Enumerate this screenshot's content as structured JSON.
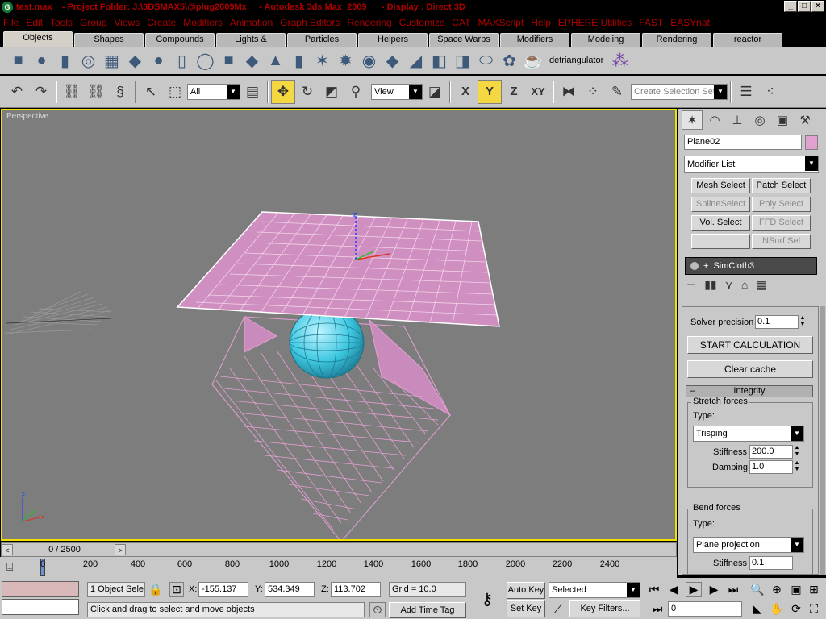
{
  "window": {
    "title": "test.max    - Project Folder: J:\\3DSMAX5\\@plug2009Mx     - Autodesk 3ds Max  2009      - Display : Direct 3D",
    "controls": [
      "_",
      "□",
      "×"
    ]
  },
  "menu": [
    "File",
    "Edit",
    "Tools",
    "Group",
    "Views",
    "Create",
    "Modifiers",
    "Animation",
    "Graph Editors",
    "Rendering",
    "Customize",
    "CAT",
    "MAXScript",
    "Help",
    "EPHERE Utilities",
    "FAST",
    "EASYnat"
  ],
  "tabs": [
    {
      "label": "Objects",
      "active": true
    },
    {
      "label": "Shapes"
    },
    {
      "label": "Compounds"
    },
    {
      "label": "Lights & Cameras"
    },
    {
      "label": "Particles"
    },
    {
      "label": "Helpers"
    },
    {
      "label": "Space Warps"
    },
    {
      "label": "Modifiers"
    },
    {
      "label": "Modeling"
    },
    {
      "label": "Rendering"
    },
    {
      "label": "reactor"
    }
  ],
  "obj_toolbar": {
    "icons": [
      "box-icon",
      "sphere-icon",
      "cylinder-icon",
      "torus-icon",
      "plane-icon",
      "box2-icon",
      "geosphere-icon",
      "tube-icon",
      "ring-icon",
      "chamferbox-icon",
      "pyramid-icon",
      "cone-icon",
      "oiltank-icon",
      "hedra-icon",
      "gear-icon",
      "capsule-icon",
      "spindle-icon",
      "prism-icon",
      "lext-icon",
      "cext-icon",
      "hose-icon",
      "knot-icon",
      "teapot-icon"
    ],
    "detriangulator_label": "detriangulator"
  },
  "main_toolbar": {
    "selection_filter": "All",
    "ref_coord": "View",
    "named_selection_placeholder": "Create Selection Set",
    "axis_x": "X",
    "axis_y": "Y",
    "axis_z": "Z",
    "axis_xy": "XY"
  },
  "viewport": {
    "label": "Perspective",
    "gizmo_axes": [
      "z",
      "x",
      "y"
    ]
  },
  "command_panel": {
    "object_name": "Plane02",
    "object_color": "#e0a0d0",
    "modifier_list": "Modifier List",
    "modifier_buttons": [
      {
        "label": "Mesh Select",
        "enabled": true
      },
      {
        "label": "Patch Select",
        "enabled": true
      },
      {
        "label": "SplineSelect",
        "enabled": false
      },
      {
        "label": "Poly Select",
        "enabled": false
      },
      {
        "label": "Vol. Select",
        "enabled": true
      },
      {
        "label": "FFD Select",
        "enabled": false
      },
      {
        "label": "",
        "enabled": true
      },
      {
        "label": "NSurf Sel",
        "enabled": false
      }
    ],
    "stack_item": "SimCloth3",
    "solver_precision_label": "Solver precision",
    "solver_precision_value": "0.1",
    "start_calculation": "START CALCULATION",
    "clear_cache": "Clear cache",
    "integrity_header": "Integrity",
    "stretch_forces": {
      "title": "Stretch forces",
      "type_label": "Type:",
      "type_value": "Trisping",
      "stiffness_label": "Stiffness",
      "stiffness_value": "200.0",
      "damping_label": "Damping",
      "damping_value": "1.0"
    },
    "bend_forces": {
      "title": "Bend forces",
      "type_label": "Type:",
      "type_value": "Plane projection",
      "stiffness_label": "Stiffness",
      "stiffness_value": "0.1"
    }
  },
  "timeslider": {
    "value": "0 / 2500",
    "prev": "<",
    "next": ">"
  },
  "trackbar": {
    "ticks": [
      "0",
      "200",
      "400",
      "600",
      "800",
      "1000",
      "1200",
      "1400",
      "1600",
      "1800",
      "2000",
      "2200",
      "2400"
    ]
  },
  "status": {
    "selection_count": "1 Object Sele",
    "x_label": "X:",
    "x_value": "-155.137",
    "y_label": "Y:",
    "y_value": "534.349",
    "z_label": "Z:",
    "z_value": "113.702",
    "grid": "Grid = 10.0",
    "prompt": "Click and drag to select and move objects",
    "add_time_tag": "Add Time Tag",
    "auto_key": "Auto Key",
    "set_key": "Set Key",
    "key_mode": "Selected",
    "key_filters": "Key Filters...",
    "current_frame": "0"
  }
}
